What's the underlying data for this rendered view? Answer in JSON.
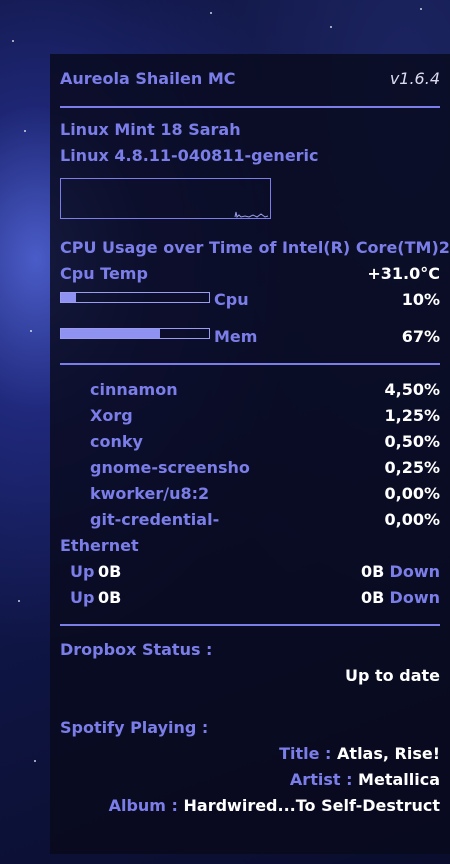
{
  "header": {
    "title": "Aureola Shailen MC",
    "version": "v1.6.4"
  },
  "system": {
    "distro": "Linux Mint 18 Sarah",
    "kernel": "Linux 4.8.11-040811-generic"
  },
  "cpu": {
    "graph_label": "CPU Usage over Time of Intel(R) Core(TM)2",
    "temp_label": "Cpu Temp",
    "temp_value": "+31.0°C",
    "cpu_label": "Cpu",
    "cpu_value": "10%",
    "cpu_level": 0.1,
    "mem_label": "Mem",
    "mem_value": "67%",
    "mem_level": 0.67
  },
  "processes": [
    {
      "name": "cinnamon",
      "value": "4,50%"
    },
    {
      "name": "Xorg",
      "value": "1,25%"
    },
    {
      "name": "conky",
      "value": "0,50%"
    },
    {
      "name": "gnome-screensho",
      "value": "0,25%"
    },
    {
      "name": "kworker/u8:2",
      "value": "0,00%"
    },
    {
      "name": "git-credential-",
      "value": "0,00%"
    }
  ],
  "network": {
    "label": "Ethernet",
    "rows": [
      {
        "up_label": "Up",
        "up_value": "0B",
        "down_value": "0B",
        "down_label": "Down"
      },
      {
        "up_label": "Up",
        "up_value": "0B",
        "down_value": "0B",
        "down_label": "Down"
      }
    ]
  },
  "dropbox": {
    "label": "Dropbox Status :",
    "status": "Up to date"
  },
  "spotify": {
    "label": "Spotify Playing :",
    "title_label": "Title :",
    "title": "Atlas, Rise!",
    "artist_label": "Artist :",
    "artist": "Metallica",
    "album_label": "Album :",
    "album": "Hardwired...To Self-Destruct"
  },
  "colors": {
    "accent": "#7b7ee8",
    "value": "#ffffff",
    "background": "#080a1c"
  }
}
